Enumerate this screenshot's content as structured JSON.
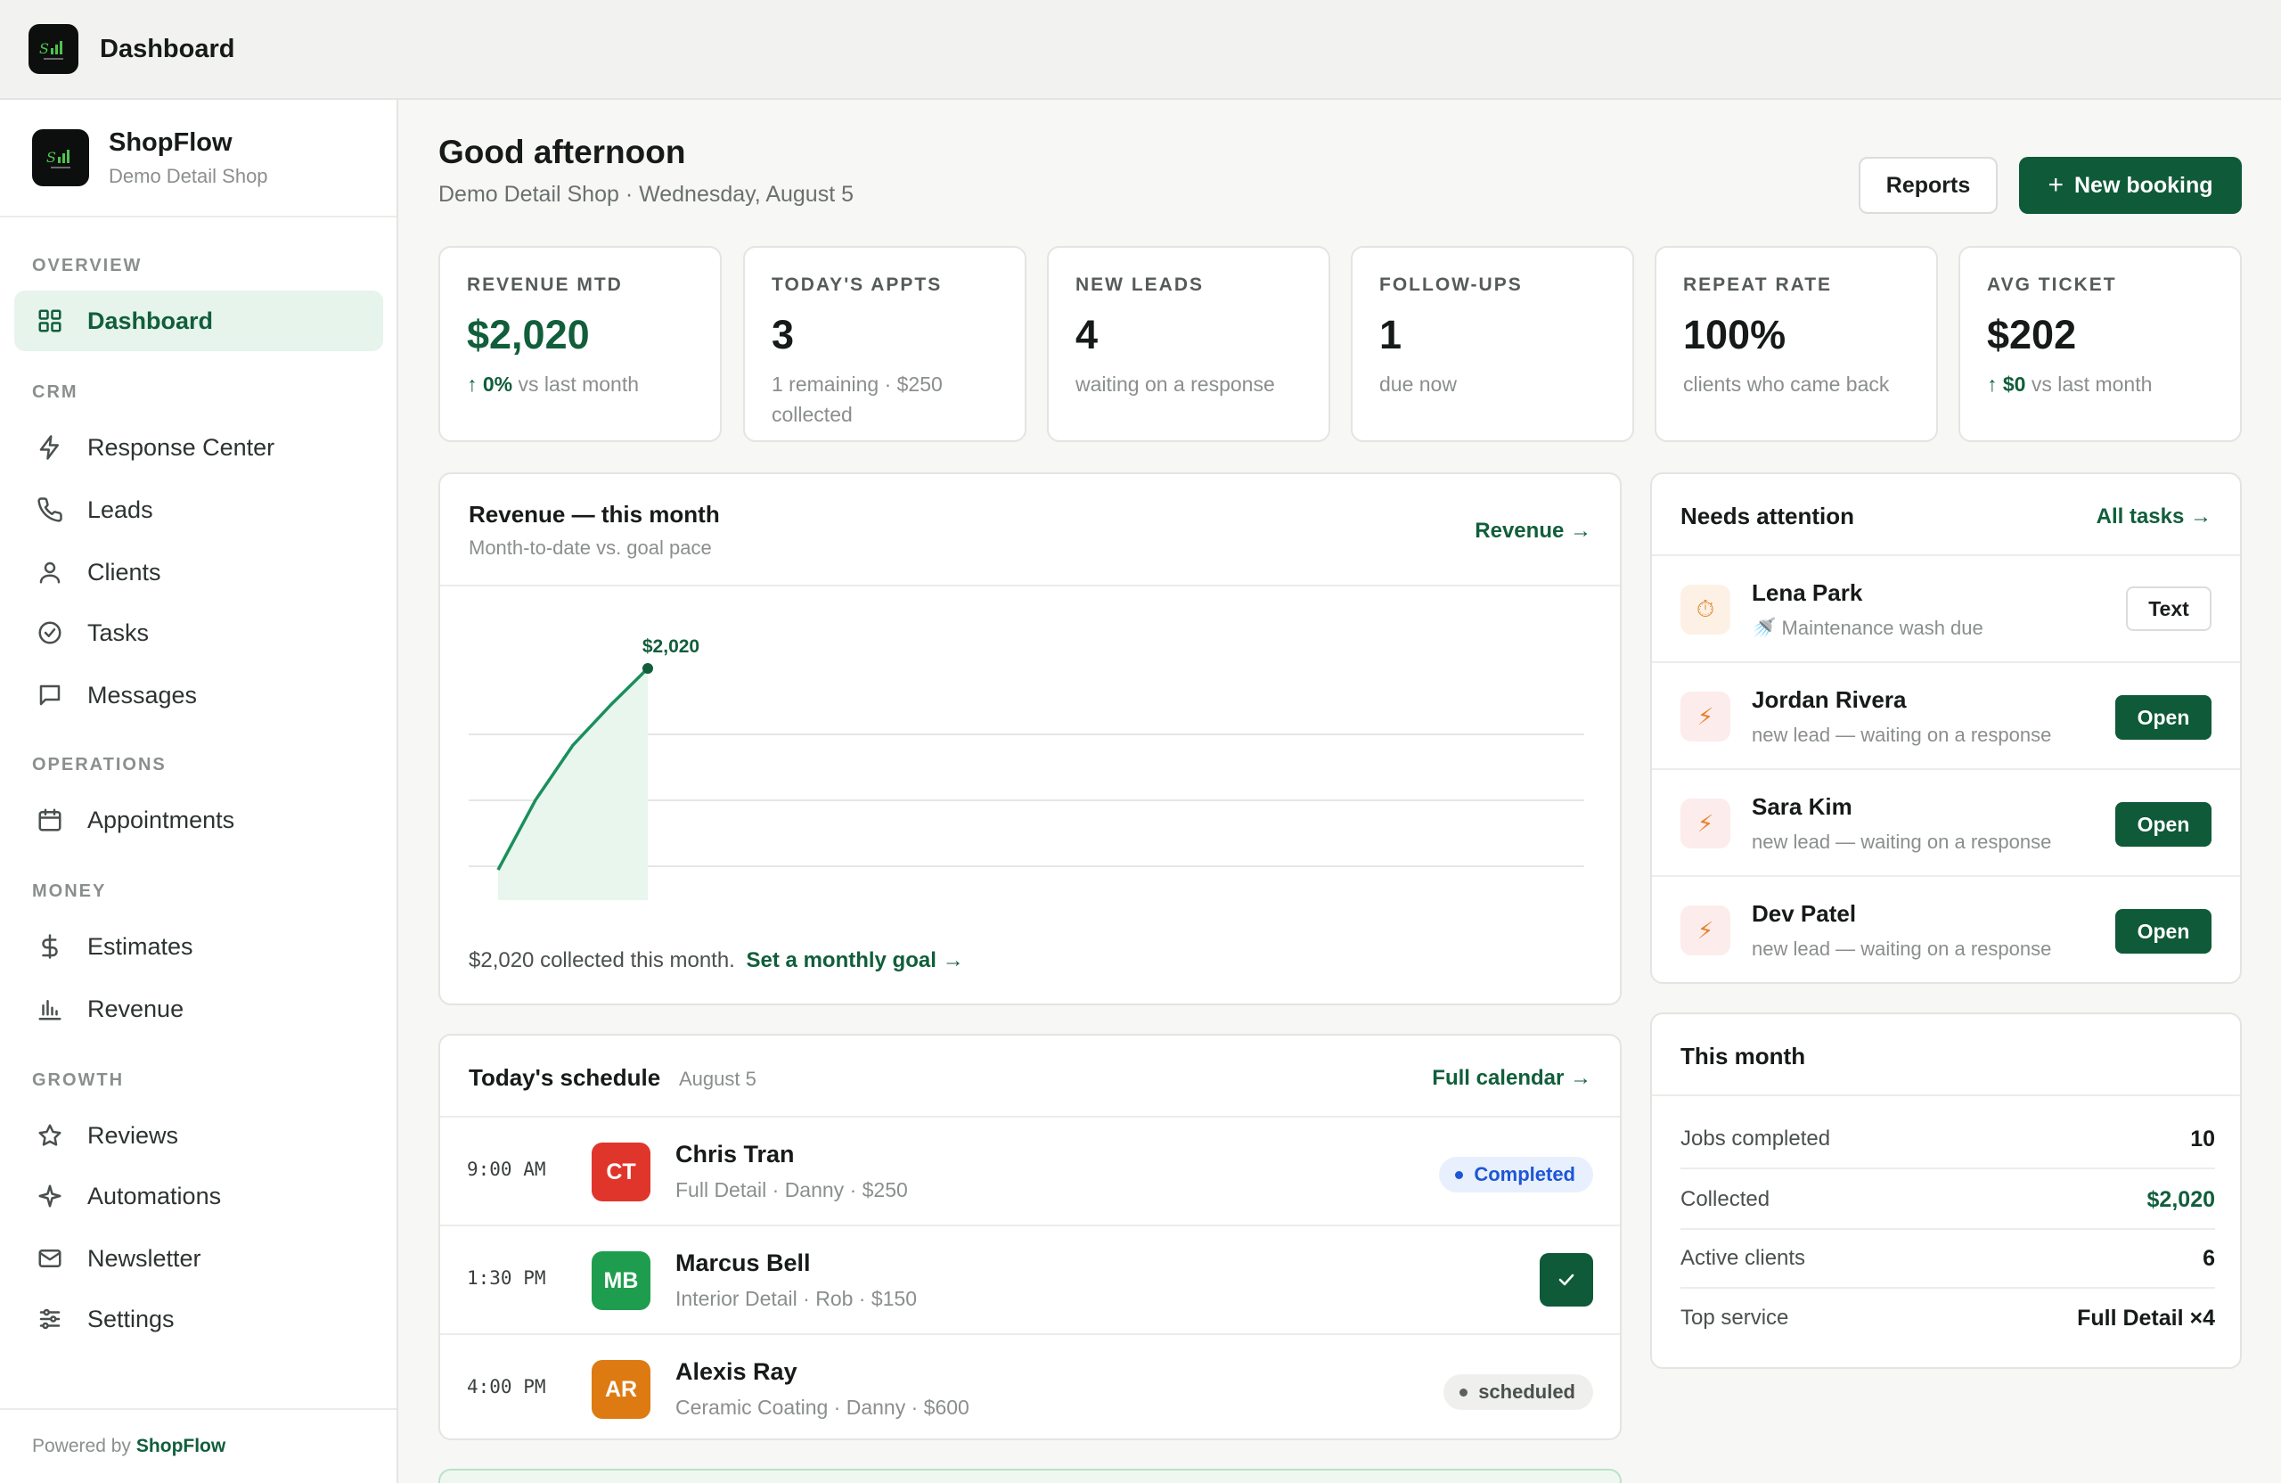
{
  "topbar": {
    "title": "Dashboard",
    "logo_icon": "shopflow-logo-icon"
  },
  "brand": {
    "name": "ShopFlow",
    "shop": "Demo Detail Shop"
  },
  "sidebar": {
    "sections": {
      "overview": "OVERVIEW",
      "crm": "CRM",
      "operations": "OPERATIONS",
      "money": "MONEY",
      "growth": "GROWTH"
    },
    "items": [
      {
        "label": "Dashboard",
        "icon": "grid-icon",
        "active": true
      },
      {
        "label": "Response Center",
        "icon": "lightning-icon"
      },
      {
        "label": "Leads",
        "icon": "phone-icon"
      },
      {
        "label": "Clients",
        "icon": "user-icon"
      },
      {
        "label": "Tasks",
        "icon": "check-circle-icon"
      },
      {
        "label": "Messages",
        "icon": "message-icon"
      },
      {
        "label": "Appointments",
        "icon": "calendar-icon"
      },
      {
        "label": "Estimates",
        "icon": "dollar-icon"
      },
      {
        "label": "Revenue",
        "icon": "bar-chart-icon"
      },
      {
        "label": "Reviews",
        "icon": "star-icon"
      },
      {
        "label": "Automations",
        "icon": "sparkle-icon"
      },
      {
        "label": "Newsletter",
        "icon": "mail-icon"
      },
      {
        "label": "Settings",
        "icon": "sliders-icon"
      }
    ],
    "footer_prefix": "Powered by",
    "footer_brand": "ShopFlow"
  },
  "header": {
    "greeting": "Good afternoon",
    "subtitle": "Demo Detail Shop  ·  Wednesday, August 5",
    "reports_label": "Reports",
    "new_booking_label": "New booking"
  },
  "kpis": [
    {
      "label": "REVENUE MTD",
      "value": "$2,020",
      "delta": "0%",
      "sub": "vs last month",
      "accent": "#115e3b"
    },
    {
      "label": "TODAY'S APPTS",
      "value": "3",
      "sub": "1 remaining · $250 collected"
    },
    {
      "label": "NEW LEADS",
      "value": "4",
      "sub": "waiting on a response"
    },
    {
      "label": "FOLLOW-UPS",
      "value": "1",
      "sub": "due now"
    },
    {
      "label": "REPEAT RATE",
      "value": "100%",
      "sub": "clients who came back"
    },
    {
      "label": "AVG TICKET",
      "value": "$202",
      "delta": "$0",
      "sub": "vs last month"
    }
  ],
  "revenue_card": {
    "title": "Revenue — this month",
    "subtitle": "Month-to-date vs. goal pace",
    "link": "Revenue →",
    "point_label": "$2,020",
    "footer_text": "$2,020 collected this month.",
    "footer_link": "Set a monthly goal →",
    "line_color": "#1a8f5c",
    "area_color": "#e8f6ee"
  },
  "chart_data": {
    "type": "area",
    "x": [
      1,
      2,
      3,
      4,
      5
    ],
    "values": [
      0,
      700,
      1250,
      1650,
      2020
    ],
    "point_label": "$2,020",
    "grid": true
  },
  "schedule": {
    "title": "Today's schedule",
    "date": "August 5",
    "link": "Full calendar →",
    "rows": [
      {
        "time": "9:00 AM",
        "initials": "CT",
        "color": "#e0352b",
        "name": "Chris Tran",
        "meta": "Full Detail · Danny · $250",
        "status": "Completed"
      },
      {
        "time": "1:30 PM",
        "initials": "MB",
        "color": "#1f9d4e",
        "name": "Marcus Bell",
        "meta": "Interior Detail · Rob · $150",
        "status": "check"
      },
      {
        "time": "4:00 PM",
        "initials": "AR",
        "color": "#dd7a12",
        "name": "Alexis Ray",
        "meta": "Ceramic Coating · Danny · $600",
        "status": "scheduled"
      }
    ]
  },
  "attention": {
    "title": "Needs attention",
    "link": "All tasks →",
    "rows": [
      {
        "name": "Lena Park",
        "meta": "🚿 Maintenance wash due",
        "icon": "timer-icon",
        "action": "Text"
      },
      {
        "name": "Jordan Rivera",
        "meta": "new lead — waiting on a response",
        "icon": "lightning-icon",
        "action": "Open"
      },
      {
        "name": "Sara Kim",
        "meta": "new lead — waiting on a response",
        "icon": "lightning-icon",
        "action": "Open"
      },
      {
        "name": "Dev Patel",
        "meta": "new lead — waiting on a response",
        "icon": "lightning-icon",
        "action": "Open"
      }
    ]
  },
  "this_month": {
    "title": "This month",
    "rows": [
      {
        "label": "Jobs completed",
        "value": "10"
      },
      {
        "label": "Collected",
        "value": "$2,020"
      },
      {
        "label": "Active clients",
        "value": "6"
      },
      {
        "label": "Top service",
        "value": "Full Detail ×4"
      }
    ]
  }
}
